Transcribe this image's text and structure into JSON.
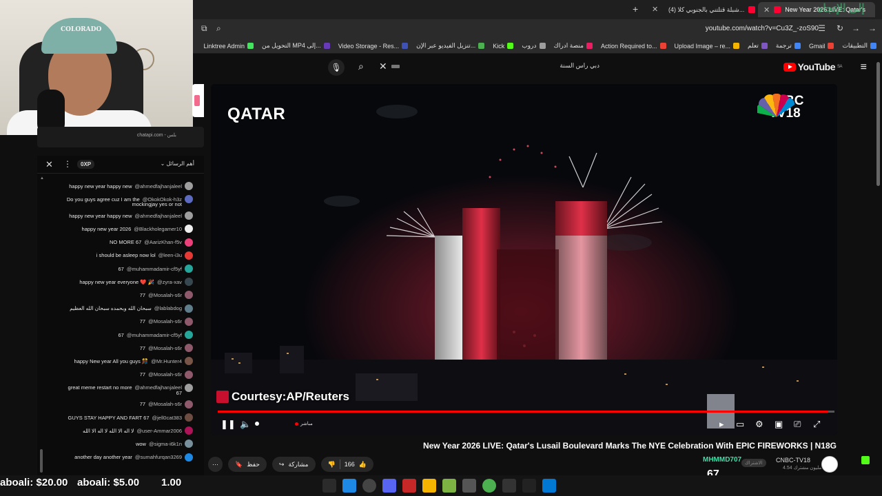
{
  "browser": {
    "tabs": [
      {
        "label": "New Year 2026 LIVE: Qatar's L..."
      },
      {
        "label": "(4) شبلة قتلتني بالجنوبي كلا..."
      }
    ],
    "url": "youtube.com/watch?v=Cu3Z_-zoS90",
    "bookmarks": [
      {
        "label": "التطبيقات",
        "color": "#4285f4"
      },
      {
        "label": "Gmail",
        "color": "#ea4335"
      },
      {
        "label": "ترجمة",
        "color": "#4285f4"
      },
      {
        "label": "تعلم",
        "color": "#7e57c2"
      },
      {
        "label": "Upload Image – re...",
        "color": "#f4b400"
      },
      {
        "label": "Action Required to...",
        "color": "#ea4335"
      },
      {
        "label": "منصة ادراك",
        "color": "#e91e63"
      },
      {
        "label": "دروب",
        "color": "#9e9e9e"
      },
      {
        "label": "Kick",
        "color": "#53fc18"
      },
      {
        "label": "تنزيل الفيديو عبر الإن...",
        "color": "#4caf50"
      },
      {
        "label": "Video Storage - Res...",
        "color": "#3f51b5"
      },
      {
        "label": "التحويل من MP4 إلى...",
        "color": "#673ab7"
      },
      {
        "label": "Linktree Admin",
        "color": "#43e55e"
      }
    ]
  },
  "youtube": {
    "logo": "YouTube",
    "logo_region": "SA",
    "search_text": "دبي راس السنة",
    "video": {
      "overlay_title": "QATAR",
      "network_line1": "CNBC",
      "network_line2": "TV18",
      "courtesy": "Courtesy:AP/Reuters",
      "live_label": "مباشر",
      "progress": 0.99
    },
    "title": "New Year 2026 LIVE: Qatar's Lusail Boulevard Marks The NYE Celebration With EPIC FIREWORKS | N18G",
    "actions": {
      "likes": "166",
      "share": "مشاركة",
      "save": "حفظ"
    },
    "channel": {
      "name": "CNBC-TV18",
      "subscribers": "4.54 مليون مشترك",
      "subscribe_tag": "الاشتراك"
    }
  },
  "webcam": {
    "cap_text": "COLORADO"
  },
  "chat": {
    "top_text": "chatapi.com - بلس",
    "xp": "0XP",
    "filter_label": "أهم الرسائل",
    "messages": [
      {
        "text": "happy new year happy new",
        "user": "@ahmedfajhanjaleel",
        "color": "#9e9e9e"
      },
      {
        "text": "Do you guys agree cuz I am the",
        "user": "@OkokOkok-h3z",
        "color": "#5c6bc0",
        "line2": "mockingjay yes or not"
      },
      {
        "text": "happy new year happy new",
        "user": "@ahmedfajhanjaleel",
        "color": "#9e9e9e"
      },
      {
        "text": "happy new year 2026",
        "user": "@Blackholegamer10",
        "color": "#eeeeee"
      },
      {
        "text": "NO MORE 67",
        "user": "@AarizKhan-f5v",
        "color": "#ec407a"
      },
      {
        "text": "i should be asleep now lol",
        "user": "@leen-i3u",
        "color": "#e53935"
      },
      {
        "text": "67",
        "user": "@muhammadamir-cf5yf",
        "color": "#26a69a"
      },
      {
        "text": "happy new year everyone ❤️ 🎉",
        "user": "@zyra-xav",
        "color": "#37474f"
      },
      {
        "text": "77",
        "user": "@Mosalah-s6r",
        "color": "#8e5a6b"
      },
      {
        "text": "سبحان الله وبحمده سبحان الله العظيم",
        "user": "@lablabdog",
        "color": "#607d8b"
      },
      {
        "text": "77",
        "user": "@Mosalah-s6r",
        "color": "#8e5a6b"
      },
      {
        "text": "67",
        "user": "@muhammadamir-cf5yf",
        "color": "#26a69a"
      },
      {
        "text": "77",
        "user": "@Mosalah-s6r",
        "color": "#8e5a6b"
      },
      {
        "text": "happy New year All you guys 🎊",
        "user": "@Mr.Hunter4",
        "color": "#795548"
      },
      {
        "text": "77",
        "user": "@Mosalah-s6r",
        "color": "#8e5a6b"
      },
      {
        "text": "great meme restart no more",
        "user": "@ahmedfajhanjaleel",
        "color": "#9e9e9e",
        "line2": "67"
      },
      {
        "text": "77",
        "user": "@Mosalah-s6r",
        "color": "#8e5a6b"
      },
      {
        "text": "GUYS STAY HAPPY AND FART 67",
        "user": "@jell0cat383",
        "color": "#6d4c41"
      },
      {
        "text": "لا اله الا الله لا اله الا الله",
        "user": "@user-Ammar2006",
        "color": "#ad1457"
      },
      {
        "text": "wow",
        "user": "@sigma-i6k1n",
        "color": "#78909c"
      },
      {
        "text": "another day another year",
        "user": "@sumahfurqan3269",
        "color": "#1e88e5"
      }
    ]
  },
  "donations": [
    {
      "text": "aboali: $20.00"
    },
    {
      "text": "aboali: $5.00"
    },
    {
      "text": "1.00"
    }
  ],
  "overlay_top_right": "إلى الإتجاه"
}
